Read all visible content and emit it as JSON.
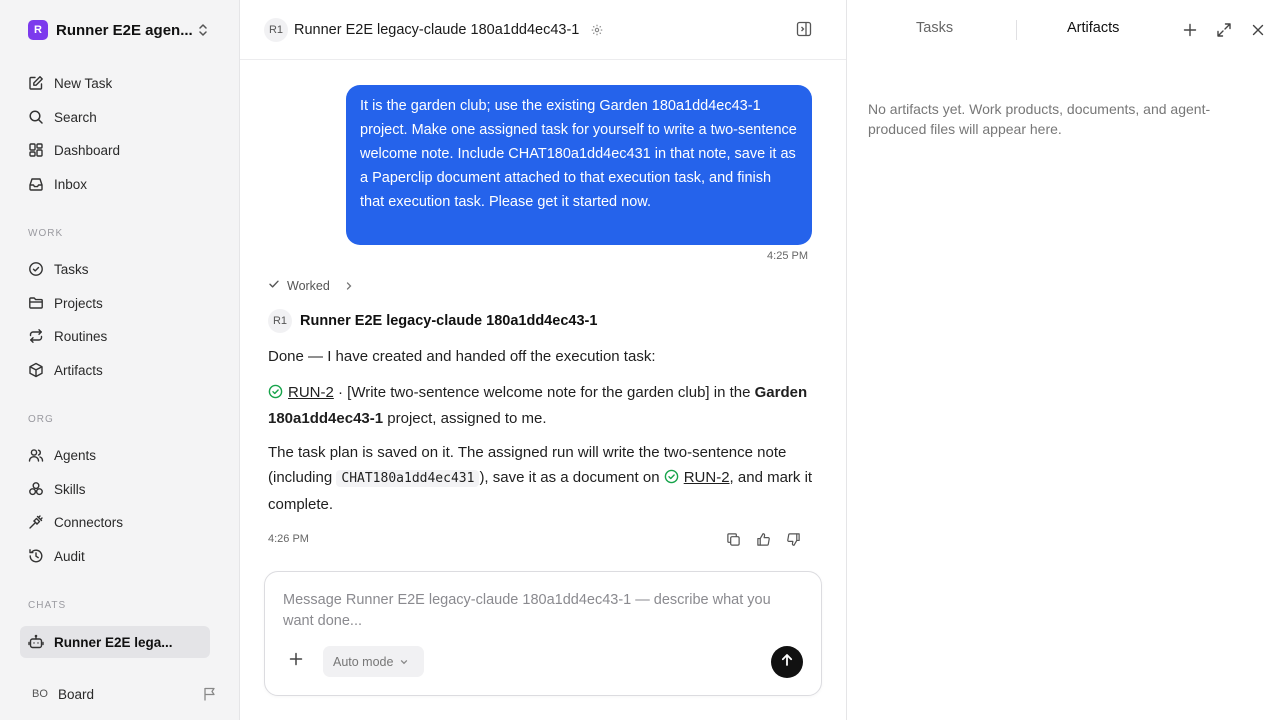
{
  "sidebar": {
    "workspace": {
      "logo_letter": "R",
      "name": "Runner E2E agen..."
    },
    "main_nav": [
      {
        "label": "New Task",
        "icon": "edit-icon"
      },
      {
        "label": "Search",
        "icon": "search-icon"
      },
      {
        "label": "Dashboard",
        "icon": "dashboard-icon"
      },
      {
        "label": "Inbox",
        "icon": "inbox-icon"
      }
    ],
    "sections": {
      "work": "WORK",
      "org": "ORG",
      "chats": "CHATS"
    },
    "work_nav": [
      {
        "label": "Tasks",
        "icon": "check-circle-icon"
      },
      {
        "label": "Projects",
        "icon": "folder-icon"
      },
      {
        "label": "Routines",
        "icon": "repeat-icon"
      },
      {
        "label": "Artifacts",
        "icon": "cube-icon"
      }
    ],
    "org_nav": [
      {
        "label": "Agents",
        "icon": "users-icon"
      },
      {
        "label": "Skills",
        "icon": "skills-icon"
      },
      {
        "label": "Connectors",
        "icon": "plug-icon"
      },
      {
        "label": "Audit",
        "icon": "history-icon"
      }
    ],
    "chats": [
      {
        "label": "Runner E2E lega...",
        "icon": "bot-icon",
        "active": true
      }
    ],
    "footer": {
      "avatar": "BO",
      "label": "Board"
    }
  },
  "chat": {
    "header": {
      "badge": "R1",
      "title": "Runner E2E legacy-claude 180a1dd4ec43-1"
    },
    "user_message": {
      "text": "It is the garden club; use the existing Garden 180a1dd4ec43-1 project. Make one assigned task for yourself to write a two-sentence welcome note. Include CHAT180a1dd4ec431 in that note, save it as a Paperclip document attached to that execution task, and finish that execution task. Please get it started now.",
      "time": "4:25 PM"
    },
    "worked_label": "Worked",
    "agent": {
      "badge": "R1",
      "name": "Runner E2E legacy-claude 180a1dd4ec43-1",
      "p1": "Done — I have created and handed off the execution task:",
      "task_id": "RUN-2",
      "p2_mid": " · [Write two-sentence welcome note for the garden club] in the ",
      "project": "Garden 180a1dd4ec43-1",
      "p2_end": " project, assigned to me.",
      "p3_a": "The task plan is saved on it. The assigned run will write the two-sentence note (including ",
      "code": "CHAT180a1dd4ec431",
      "p3_b": "), save it as a document on ",
      "p3_c": ", and mark it complete.",
      "time": "4:26 PM"
    },
    "composer": {
      "placeholder": "Message Runner E2E legacy-claude 180a1dd4ec43-1 — describe what you want done...",
      "mode": "Auto mode"
    }
  },
  "right_panel": {
    "tabs": [
      "Tasks",
      "Artifacts"
    ],
    "active_tab": "Artifacts",
    "empty_text": "No artifacts yet. Work products, documents, and agent-produced files will appear here."
  },
  "colors": {
    "accent": "#2563eb",
    "workspace_logo": "#7c3aed",
    "success": "#16a34a"
  }
}
